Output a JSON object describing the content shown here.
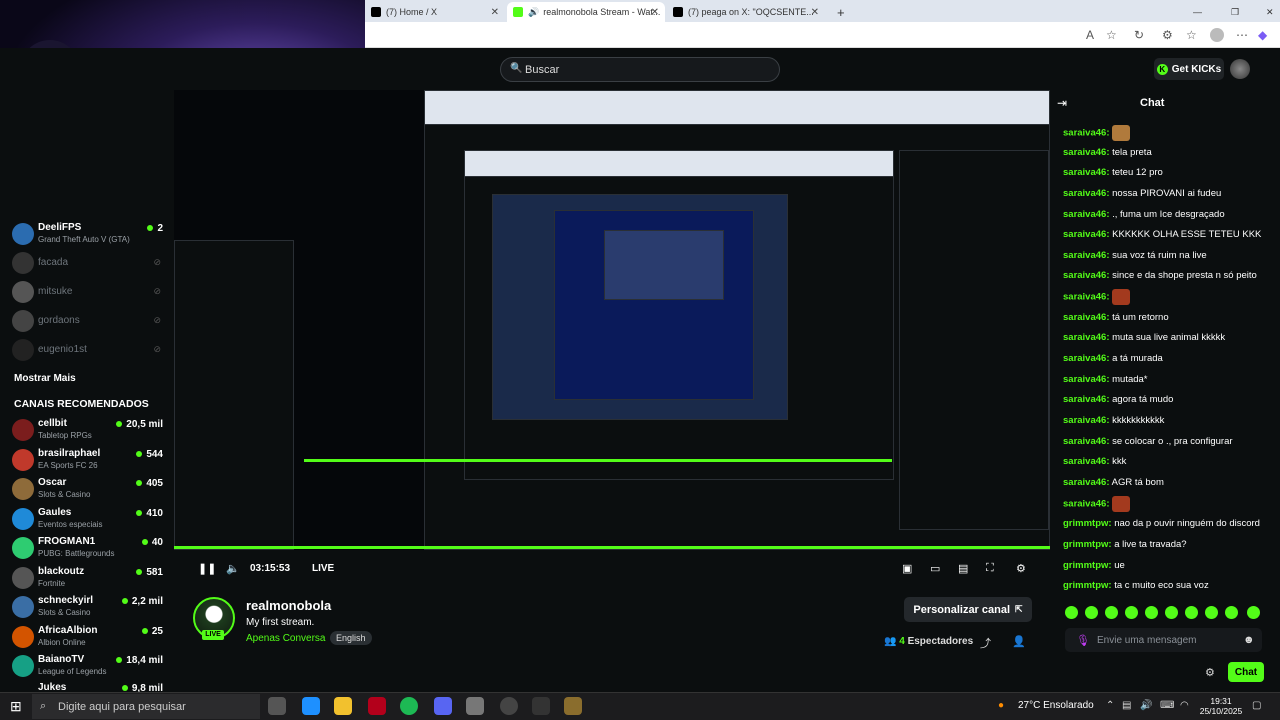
{
  "browser": {
    "tabs": [
      {
        "label": "(7) Home / X"
      },
      {
        "label": "realmonobola Stream - Wat..."
      },
      {
        "label": "(7) peaga on X: \"OQCSENTE..."
      }
    ],
    "new_tab": "+",
    "window_controls": [
      "—",
      "❐",
      "✕"
    ]
  },
  "header": {
    "search_placeholder": "Buscar",
    "get_kicks": "Get KICKs"
  },
  "sidebar": {
    "following": [
      {
        "name": "DeeliFPS",
        "game": "Grand Theft Auto V (GTA)",
        "viewers": "2",
        "color": "#2b6cb0"
      },
      {
        "name": "facada",
        "offline": true
      },
      {
        "name": "mitsuke",
        "offline": true
      },
      {
        "name": "gordaons",
        "offline": true
      },
      {
        "name": "eugenio1st",
        "offline": true
      }
    ],
    "show_more": "Mostrar Mais",
    "recommended_title": "CANAIS RECOMENDADOS",
    "recommended": [
      {
        "name": "cellbit",
        "game": "Tabletop RPGs",
        "viewers": "20,5 mil",
        "color": "#7b1d1d"
      },
      {
        "name": "brasilraphael",
        "game": "EA Sports FC 26",
        "viewers": "544",
        "color": "#c0392b"
      },
      {
        "name": "Oscar",
        "game": "Slots & Casino",
        "viewers": "405",
        "color": "#8e6b3a"
      },
      {
        "name": "Gaules",
        "game": "Eventos especiais",
        "viewers": "410",
        "color": "#1f8ad8"
      },
      {
        "name": "FROGMAN1",
        "game": "PUBG: Battlegrounds",
        "viewers": "40",
        "color": "#2ecc71"
      },
      {
        "name": "blackoutz",
        "game": "Fortnite",
        "viewers": "581",
        "color": "#555"
      },
      {
        "name": "schneckyirl",
        "game": "Slots & Casino",
        "viewers": "2,2 mil",
        "color": "#3a6ea5"
      },
      {
        "name": "AfricaAlbion",
        "game": "Albion Online",
        "viewers": "25",
        "color": "#d35400"
      },
      {
        "name": "BaianoTV",
        "game": "League of Legends",
        "viewers": "18,4 mil",
        "color": "#16a085"
      },
      {
        "name": "Jukes",
        "game": "",
        "viewers": "9,8 mil",
        "color": "#8e44ad"
      }
    ]
  },
  "player": {
    "time": "03:15:53",
    "live": "LIVE"
  },
  "stream": {
    "streamer": "realmonobola",
    "title": "My first stream.",
    "category": "Apenas Conversa",
    "language": "English",
    "live_badge": "LIVE",
    "customize": "Personalizar canal",
    "viewers_count": "4",
    "viewers_label": "Espectadores"
  },
  "chat": {
    "title": "Chat",
    "messages": [
      {
        "user": "saraiva46:",
        "text": "",
        "emote": "#b07a3c"
      },
      {
        "user": "saraiva46:",
        "text": "tela preta"
      },
      {
        "user": "saraiva46:",
        "text": "teteu 12 pro"
      },
      {
        "user": "saraiva46:",
        "text": "nossa PIROVANI ai fudeu"
      },
      {
        "user": "saraiva46:",
        "text": "., fuma um Ice desgraçado"
      },
      {
        "user": "saraiva46:",
        "text": "KKKKKK OLHA ESSE TETEU KKK"
      },
      {
        "user": "saraiva46:",
        "text": "sua voz tá ruim na live"
      },
      {
        "user": "saraiva46:",
        "text": "since e da shope presta n só peito"
      },
      {
        "user": "saraiva46:",
        "text": "",
        "emote": "#a33a1e"
      },
      {
        "user": "saraiva46:",
        "text": "tá um retorno"
      },
      {
        "user": "saraiva46:",
        "text": "muta sua live animal kkkkk"
      },
      {
        "user": "saraiva46:",
        "text": "a tá murada"
      },
      {
        "user": "saraiva46:",
        "text": "mutada*"
      },
      {
        "user": "saraiva46:",
        "text": "agora tá mudo"
      },
      {
        "user": "saraiva46:",
        "text": "kkkkkkkkkkk"
      },
      {
        "user": "saraiva46:",
        "text": "se colocar o ., pra configurar"
      },
      {
        "user": "saraiva46:",
        "text": "kkk"
      },
      {
        "user": "saraiva46:",
        "text": "AGR tá bom"
      },
      {
        "user": "saraiva46:",
        "text": "",
        "emote": "#a33a1e"
      },
      {
        "user": "grimmtpw:",
        "text": "nao da p ouvir ninguém do discord"
      },
      {
        "user": "grimmtpw:",
        "text": "a live ta travada?"
      },
      {
        "user": "grimmtpw:",
        "text": "ue"
      },
      {
        "user": "grimmtpw:",
        "text": "ta c muito eco sua voz"
      }
    ],
    "input_placeholder": "Envie uma mensagem",
    "send_label": "Chat"
  },
  "taskbar": {
    "search_placeholder": "Digite aqui para pesquisar",
    "weather": "27°C  Ensolarado",
    "time": "19:31",
    "date": "25/10/2025"
  },
  "colors": {
    "kick_green": "#53fc18",
    "bg": "#0b0e0f"
  }
}
